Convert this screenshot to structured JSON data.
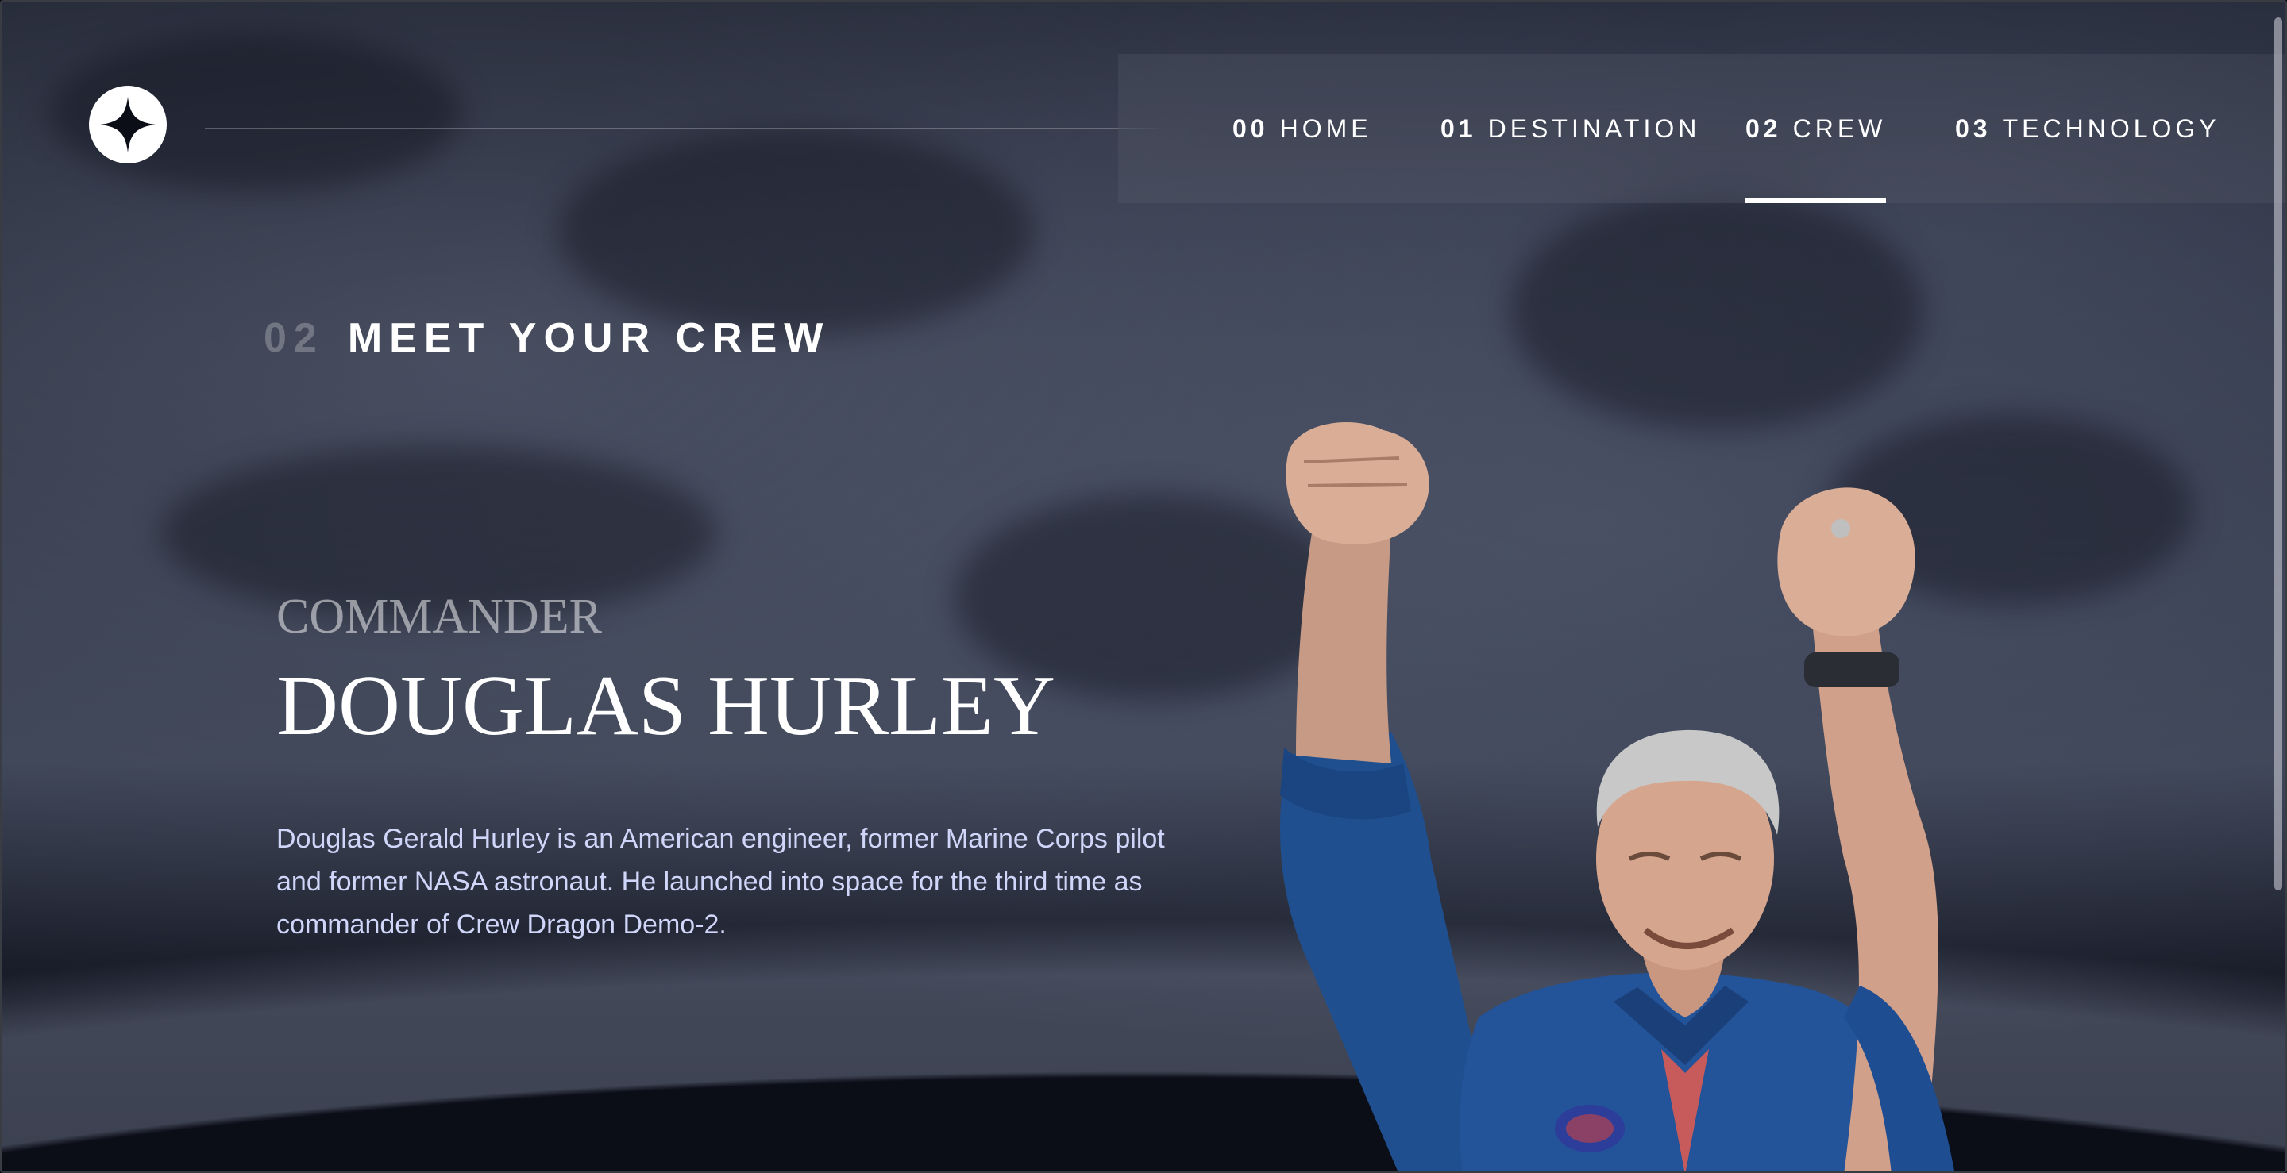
{
  "header": {
    "logo_icon": "star-icon",
    "nav": [
      {
        "num": "00",
        "label": "HOME",
        "active": false
      },
      {
        "num": "01",
        "label": "DESTINATION",
        "active": false
      },
      {
        "num": "02",
        "label": "CREW",
        "active": true
      },
      {
        "num": "03",
        "label": "TECHNOLOGY",
        "active": false
      }
    ]
  },
  "section": {
    "num": "02",
    "title": "MEET YOUR CREW"
  },
  "crew": {
    "role": "COMMANDER",
    "name": "DOUGLAS HURLEY",
    "bio": "Douglas Gerald Hurley is an American engineer, former Marine Corps pilot and former NASA astronaut. He launched into space for the third time as commander of Crew Dragon Demo-2."
  },
  "colors": {
    "background": "#0b0d17",
    "accent_text": "#d0d6f9",
    "white": "#ffffff"
  }
}
